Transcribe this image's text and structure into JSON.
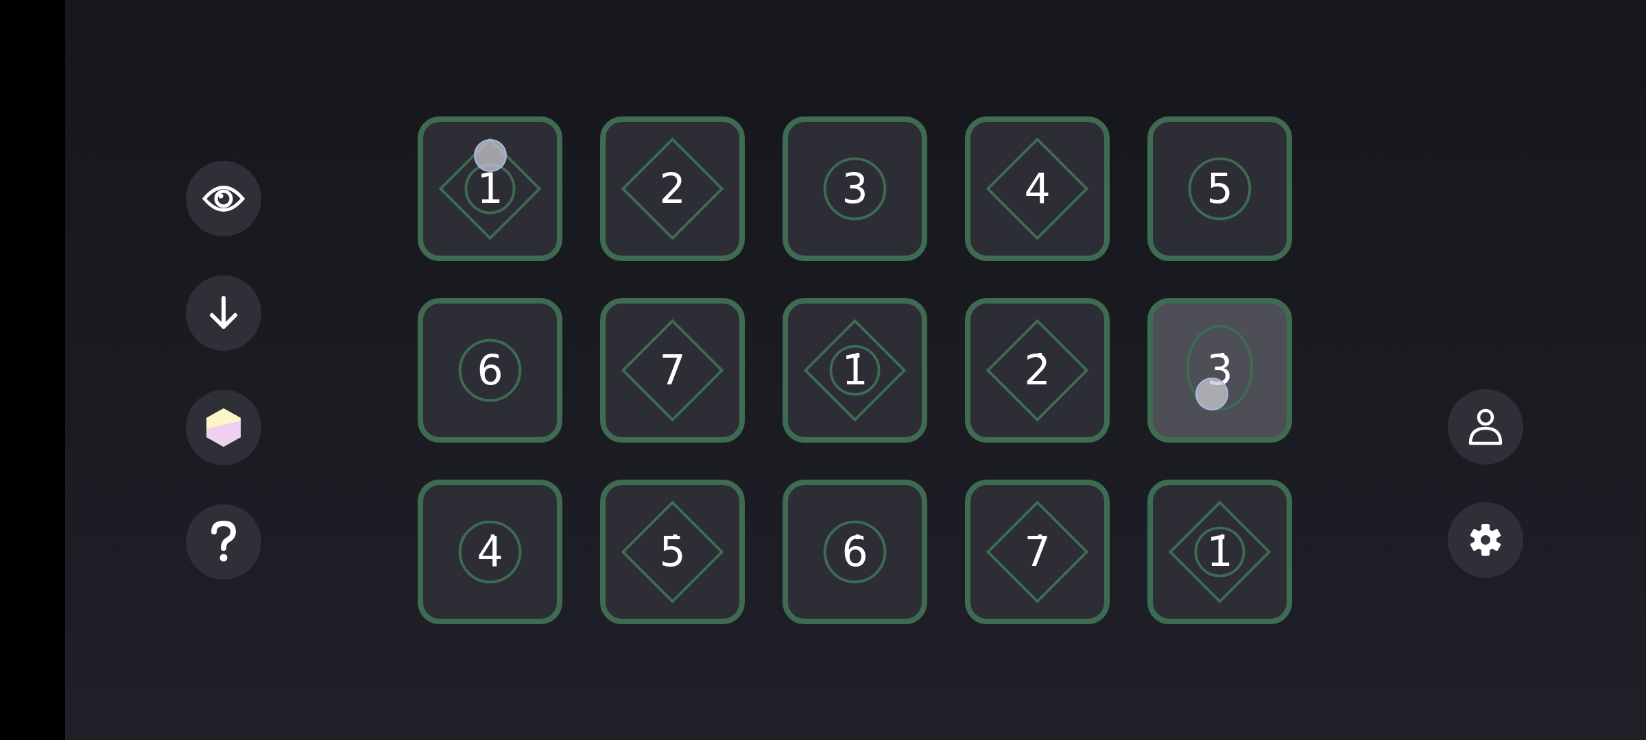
{
  "pads": [
    {
      "label": "1",
      "kind": "both",
      "pressed": false,
      "touched": true
    },
    {
      "label": "2",
      "kind": "diamond",
      "pressed": false,
      "touched": false
    },
    {
      "label": "3",
      "kind": "circle",
      "pressed": false,
      "touched": false
    },
    {
      "label": "4",
      "kind": "diamond",
      "pressed": false,
      "touched": false
    },
    {
      "label": "5",
      "kind": "circle",
      "pressed": false,
      "touched": false
    },
    {
      "label": "6",
      "kind": "circle",
      "pressed": false,
      "touched": false
    },
    {
      "label": "7",
      "kind": "diamond",
      "pressed": false,
      "touched": false
    },
    {
      "label": "1̇",
      "kind": "both",
      "pressed": false,
      "touched": false
    },
    {
      "label": "2̇",
      "kind": "diamond",
      "pressed": false,
      "touched": false
    },
    {
      "label": "3̇",
      "kind": "circle",
      "pressed": true,
      "touched": true
    },
    {
      "label": "4̇",
      "kind": "circle",
      "pressed": false,
      "touched": false
    },
    {
      "label": "5̇",
      "kind": "diamond",
      "pressed": false,
      "touched": false
    },
    {
      "label": "6̇",
      "kind": "circle",
      "pressed": false,
      "touched": false
    },
    {
      "label": "7̇",
      "kind": "diamond",
      "pressed": false,
      "touched": false
    },
    {
      "label": "1̇̇",
      "kind": "both",
      "pressed": false,
      "touched": false
    }
  ]
}
